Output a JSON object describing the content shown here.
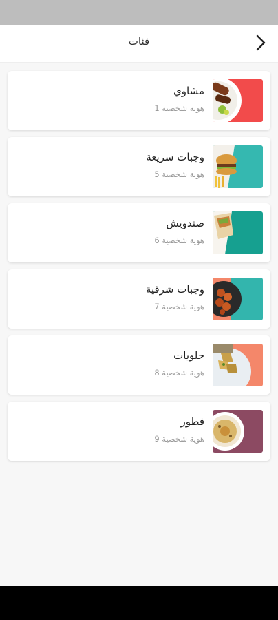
{
  "header": {
    "title": "فئات",
    "back_icon": "chevron-right-icon"
  },
  "categories": [
    {
      "title": "مشاوي",
      "subtitle": "هوية شخصية 1",
      "accent": "#f24b4b",
      "image": "grilled-kebab-plate"
    },
    {
      "title": "وجبات سريعة",
      "subtitle": "هوية شخصية 5",
      "accent": "#35b8b0",
      "image": "burger-and-fries"
    },
    {
      "title": "صندويش",
      "subtitle": "هوية شخصية 6",
      "accent": "#16a090",
      "image": "wrap-sandwich"
    },
    {
      "title": "وجبات شرقية",
      "subtitle": "هوية شخصية 7",
      "accent": "#33b5ad",
      "image": "chicken-wings-bowl"
    },
    {
      "title": "حلويات",
      "subtitle": "هوية شخصية 8",
      "accent": "#f4876a",
      "image": "baklava-plate"
    },
    {
      "title": "فطور",
      "subtitle": "هوية شخصية 9",
      "accent": "#8c4a62",
      "image": "breakfast-plate"
    }
  ]
}
